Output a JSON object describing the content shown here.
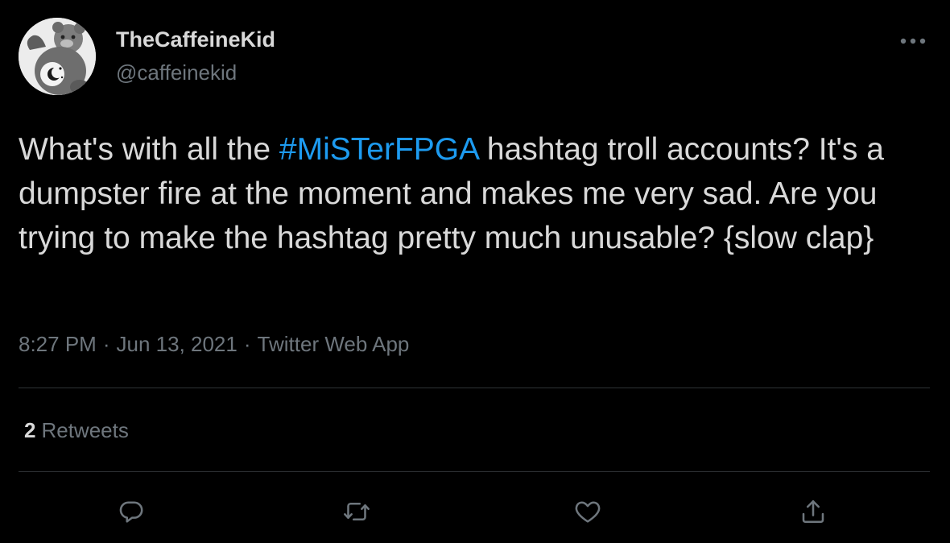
{
  "author": {
    "display_name": "TheCaffeineKid",
    "handle": "@caffeinekid",
    "avatar": "care-bear-avatar-icon"
  },
  "tweet": {
    "text_before": "What's with all the ",
    "hashtag": "#MiSTerFPGA",
    "text_after": " hashtag troll accounts? It's a dumpster fire at the moment and makes me very sad. Are you trying to make the hashtag pretty much unusable? {slow clap}"
  },
  "meta": {
    "time": "8:27 PM",
    "separator": "·",
    "date": "Jun 13, 2021",
    "source": "Twitter Web App"
  },
  "stats": {
    "retweets_count": "2",
    "retweets_label": "Retweets"
  },
  "actions": [
    {
      "name": "reply",
      "icon": "reply-icon"
    },
    {
      "name": "retweet",
      "icon": "retweet-icon"
    },
    {
      "name": "like",
      "icon": "heart-icon"
    },
    {
      "name": "share",
      "icon": "share-icon"
    }
  ],
  "colors": {
    "background": "#000000",
    "text": "#d9d9d9",
    "secondary_text": "#6e767d",
    "hashtag": "#1d9bf0",
    "divider": "#2f3336"
  }
}
